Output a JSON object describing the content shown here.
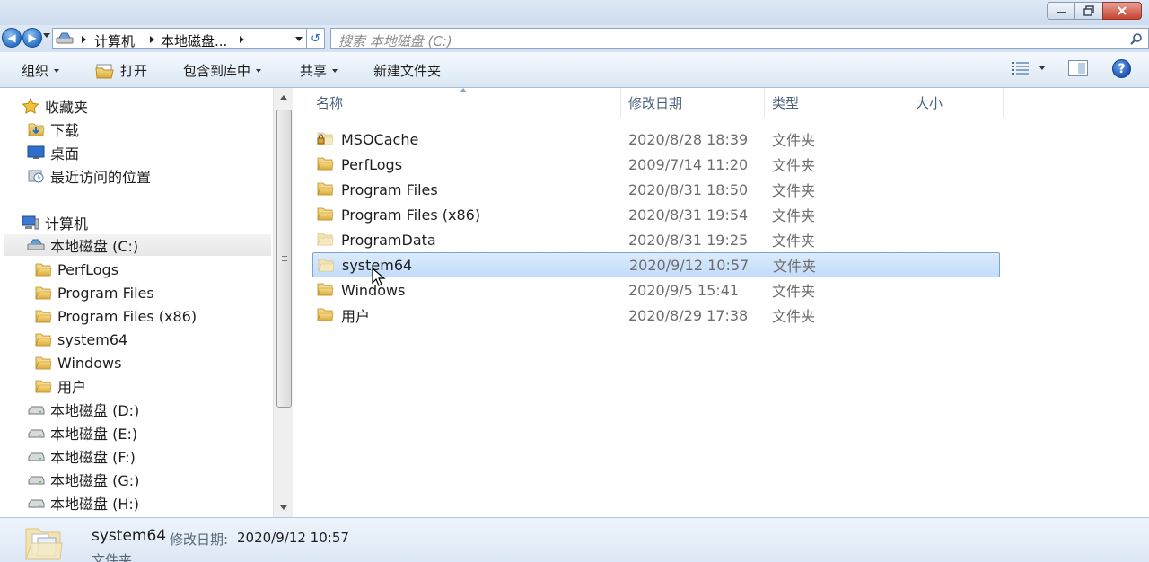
{
  "window": {
    "buttons": [
      "minimize",
      "restore",
      "close"
    ]
  },
  "address": {
    "crumbs": [
      "计算机",
      "本地磁盘..."
    ],
    "search_placeholder": "搜索 本地磁盘 (C:)"
  },
  "toolbar": {
    "organize": "组织",
    "open": "打开",
    "include_library": "包含到库中",
    "share": "共享",
    "new_folder": "新建文件夹"
  },
  "nav": {
    "favorites": "收藏夹",
    "downloads": "下载",
    "desktop": "桌面",
    "recent": "最近访问的位置",
    "computer": "计算机",
    "drive_c": "本地磁盘 (C:)",
    "c_children": [
      "PerfLogs",
      "Program Files",
      "Program Files (x86)",
      "system64",
      "Windows",
      "用户"
    ],
    "drives": [
      "本地磁盘 (D:)",
      "本地磁盘 (E:)",
      "本地磁盘 (F:)",
      "本地磁盘 (G:)",
      "本地磁盘 (H:)"
    ]
  },
  "columns": {
    "name": "名称",
    "modified": "修改日期",
    "type": "类型",
    "size": "大小"
  },
  "files": [
    {
      "name": "MSOCache",
      "date": "2020/8/28 18:39",
      "type": "文件夹",
      "icon": "locked-folder-icon"
    },
    {
      "name": "PerfLogs",
      "date": "2009/7/14 11:20",
      "type": "文件夹",
      "icon": "folder-icon"
    },
    {
      "name": "Program Files",
      "date": "2020/8/31 18:50",
      "type": "文件夹",
      "icon": "folder-icon"
    },
    {
      "name": "Program Files (x86)",
      "date": "2020/8/31 19:54",
      "type": "文件夹",
      "icon": "folder-icon"
    },
    {
      "name": "ProgramData",
      "date": "2020/8/31 19:25",
      "type": "文件夹",
      "icon": "hidden-folder-icon"
    },
    {
      "name": "system64",
      "date": "2020/9/12 10:57",
      "type": "文件夹",
      "icon": "hidden-folder-icon",
      "selected": true
    },
    {
      "name": "Windows",
      "date": "2020/9/5 15:41",
      "type": "文件夹",
      "icon": "folder-icon"
    },
    {
      "name": "用户",
      "date": "2020/8/29 17:38",
      "type": "文件夹",
      "icon": "folder-icon"
    }
  ],
  "details": {
    "name": "system64",
    "modified_label": "修改日期:",
    "modified_value": "2020/9/12 10:57",
    "type": "文件夹"
  },
  "colors": {
    "selection": "#c2dcfa",
    "selection_border": "#7da2ce",
    "folder": "#e9c45a"
  }
}
